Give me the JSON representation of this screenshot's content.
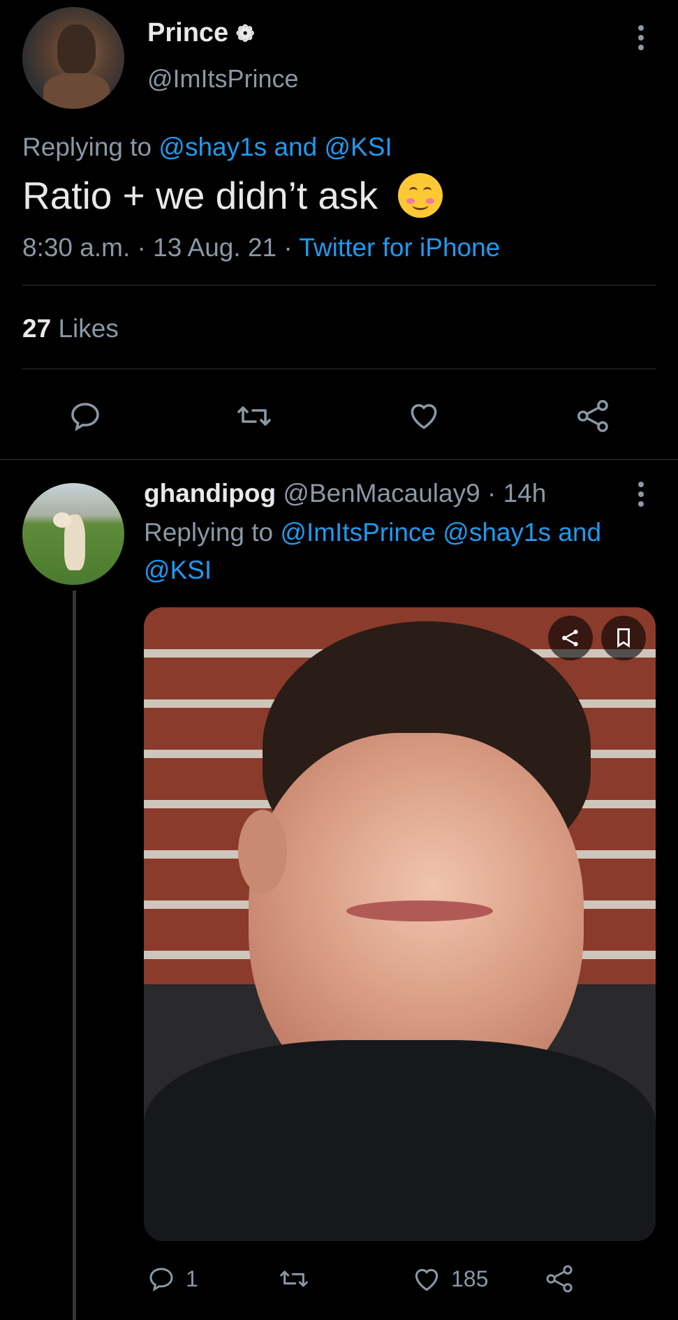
{
  "main_tweet": {
    "display_name": "Prince",
    "name_emoji": "❁",
    "handle": "@ImItsPrince",
    "replying_prefix": "Replying to",
    "replying_targets": "@shay1s and @KSI",
    "text": "Ratio + we didn’t ask",
    "emoji": "😊",
    "time": "8:30 a.m.",
    "sep1": "·",
    "date": "13 Aug. 21",
    "sep2": "·",
    "source": "Twitter for iPhone",
    "likes_count": "27",
    "likes_label": "Likes"
  },
  "reply_tweet": {
    "display_name": "ghandipog",
    "handle": "@BenMacaulay9",
    "sep": "·",
    "time": "14h",
    "replying_prefix": "Replying to",
    "replying_line1": "@ImItsPrince @shay1s and",
    "replying_line2": "@KSI",
    "reply_count": "1",
    "like_count": "185"
  },
  "icons": [
    "reply-icon",
    "retweet-icon",
    "like-icon",
    "share-icon",
    "more-icon",
    "bookmark-icon"
  ],
  "colors": {
    "accent": "#1d9bf0",
    "background": "#000000",
    "muted": "#8b98a5",
    "divider": "#2f3336"
  }
}
